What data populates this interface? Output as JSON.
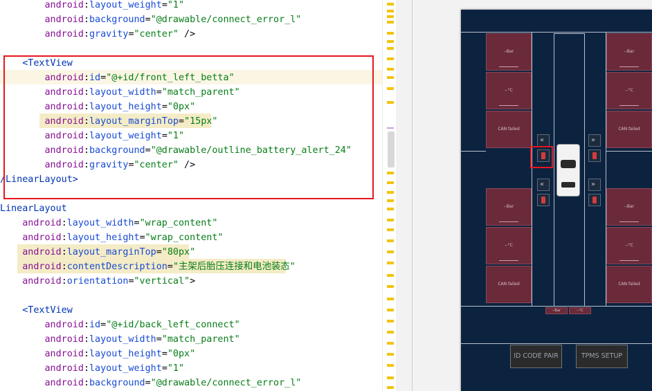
{
  "editor": {
    "lines": [
      {
        "parts": [
          {
            "c": "attr-ns",
            "t": "        android"
          },
          {
            "c": "plain",
            "t": ":"
          },
          {
            "c": "attr",
            "t": "layout_weight"
          },
          {
            "c": "plain",
            "t": "="
          },
          {
            "c": "val",
            "t": "\"1\""
          }
        ]
      },
      {
        "parts": [
          {
            "c": "attr-ns",
            "t": "        android"
          },
          {
            "c": "plain",
            "t": ":"
          },
          {
            "c": "attr",
            "t": "background"
          },
          {
            "c": "plain",
            "t": "="
          },
          {
            "c": "val",
            "t": "\"@drawable/connect_error_l\""
          }
        ]
      },
      {
        "parts": [
          {
            "c": "attr-ns",
            "t": "        android"
          },
          {
            "c": "plain",
            "t": ":"
          },
          {
            "c": "attr",
            "t": "gravity"
          },
          {
            "c": "plain",
            "t": "="
          },
          {
            "c": "val",
            "t": "\"center\""
          },
          {
            "c": "plain",
            "t": " />"
          }
        ]
      },
      {
        "parts": []
      },
      {
        "parts": [
          {
            "c": "tag",
            "t": "    <TextView"
          }
        ]
      },
      {
        "parts": [
          {
            "c": "attr-ns",
            "t": "        android"
          },
          {
            "c": "plain",
            "t": ":"
          },
          {
            "c": "attr",
            "t": "id"
          },
          {
            "c": "plain",
            "t": "="
          },
          {
            "c": "val",
            "t": "\"@+id/front_left_betta\""
          }
        ]
      },
      {
        "parts": [
          {
            "c": "attr-ns",
            "t": "        android"
          },
          {
            "c": "plain",
            "t": ":"
          },
          {
            "c": "attr",
            "t": "layout_width"
          },
          {
            "c": "plain",
            "t": "="
          },
          {
            "c": "val",
            "t": "\"match_parent\""
          }
        ]
      },
      {
        "parts": [
          {
            "c": "attr-ns",
            "t": "        android"
          },
          {
            "c": "plain",
            "t": ":"
          },
          {
            "c": "attr",
            "t": "layout_height"
          },
          {
            "c": "plain",
            "t": "="
          },
          {
            "c": "val",
            "t": "\"0px\""
          }
        ]
      },
      {
        "parts": [
          {
            "c": "attr-ns",
            "t": "        android"
          },
          {
            "c": "plain",
            "t": ":"
          },
          {
            "c": "attr",
            "t": "layout_marginTop"
          },
          {
            "c": "plain",
            "t": "="
          },
          {
            "c": "val",
            "t": "\"15px\""
          }
        ]
      },
      {
        "parts": [
          {
            "c": "attr-ns",
            "t": "        android"
          },
          {
            "c": "plain",
            "t": ":"
          },
          {
            "c": "attr",
            "t": "layout_weight"
          },
          {
            "c": "plain",
            "t": "="
          },
          {
            "c": "val",
            "t": "\"1\""
          }
        ]
      },
      {
        "parts": [
          {
            "c": "attr-ns",
            "t": "        android"
          },
          {
            "c": "plain",
            "t": ":"
          },
          {
            "c": "attr",
            "t": "background"
          },
          {
            "c": "plain",
            "t": "="
          },
          {
            "c": "val",
            "t": "\"@drawable/outline_battery_alert_24\""
          }
        ]
      },
      {
        "parts": [
          {
            "c": "attr-ns",
            "t": "        android"
          },
          {
            "c": "plain",
            "t": ":"
          },
          {
            "c": "attr",
            "t": "gravity"
          },
          {
            "c": "plain",
            "t": "="
          },
          {
            "c": "val",
            "t": "\"center\""
          },
          {
            "c": "plain",
            "t": " />"
          }
        ]
      },
      {
        "parts": [
          {
            "c": "tag",
            "t": "/LinearLayout>"
          }
        ]
      },
      {
        "parts": []
      },
      {
        "parts": [
          {
            "c": "tag",
            "t": "LinearLayout"
          }
        ]
      },
      {
        "parts": [
          {
            "c": "attr-ns",
            "t": "    android"
          },
          {
            "c": "plain",
            "t": ":"
          },
          {
            "c": "attr",
            "t": "layout_width"
          },
          {
            "c": "plain",
            "t": "="
          },
          {
            "c": "val",
            "t": "\"wrap_content\""
          }
        ]
      },
      {
        "parts": [
          {
            "c": "attr-ns",
            "t": "    android"
          },
          {
            "c": "plain",
            "t": ":"
          },
          {
            "c": "attr",
            "t": "layout_height"
          },
          {
            "c": "plain",
            "t": "="
          },
          {
            "c": "val",
            "t": "\"wrap_content\""
          }
        ]
      },
      {
        "parts": [
          {
            "c": "attr-ns",
            "t": "    android"
          },
          {
            "c": "plain",
            "t": ":"
          },
          {
            "c": "attr",
            "t": "layout_marginTop"
          },
          {
            "c": "plain",
            "t": "="
          },
          {
            "c": "val",
            "t": "\"80px\""
          }
        ]
      },
      {
        "parts": [
          {
            "c": "attr-ns",
            "t": "    android"
          },
          {
            "c": "plain",
            "t": ":"
          },
          {
            "c": "attr",
            "t": "contentDescription"
          },
          {
            "c": "plain",
            "t": "="
          },
          {
            "c": "val",
            "t": "\"主架后胎压连接和电池装态\""
          }
        ]
      },
      {
        "parts": [
          {
            "c": "attr-ns",
            "t": "    android"
          },
          {
            "c": "plain",
            "t": ":"
          },
          {
            "c": "attr",
            "t": "orientation"
          },
          {
            "c": "plain",
            "t": "="
          },
          {
            "c": "val",
            "t": "\"vertical\""
          },
          {
            "c": "plain",
            "t": ">"
          }
        ]
      },
      {
        "parts": []
      },
      {
        "parts": [
          {
            "c": "tag",
            "t": "    <TextView"
          }
        ]
      },
      {
        "parts": [
          {
            "c": "attr-ns",
            "t": "        android"
          },
          {
            "c": "plain",
            "t": ":"
          },
          {
            "c": "attr",
            "t": "id"
          },
          {
            "c": "plain",
            "t": "="
          },
          {
            "c": "val",
            "t": "\"@+id/back_left_connect\""
          }
        ]
      },
      {
        "parts": [
          {
            "c": "attr-ns",
            "t": "        android"
          },
          {
            "c": "plain",
            "t": ":"
          },
          {
            "c": "attr",
            "t": "layout_width"
          },
          {
            "c": "plain",
            "t": "="
          },
          {
            "c": "val",
            "t": "\"match_parent\""
          }
        ]
      },
      {
        "parts": [
          {
            "c": "attr-ns",
            "t": "        android"
          },
          {
            "c": "plain",
            "t": ":"
          },
          {
            "c": "attr",
            "t": "layout_height"
          },
          {
            "c": "plain",
            "t": "="
          },
          {
            "c": "val",
            "t": "\"0px\""
          }
        ]
      },
      {
        "parts": [
          {
            "c": "attr-ns",
            "t": "        android"
          },
          {
            "c": "plain",
            "t": ":"
          },
          {
            "c": "attr",
            "t": "layout_weight"
          },
          {
            "c": "plain",
            "t": "="
          },
          {
            "c": "val",
            "t": "\"1\""
          }
        ]
      },
      {
        "parts": [
          {
            "c": "attr-ns",
            "t": "        android"
          },
          {
            "c": "plain",
            "t": ":"
          },
          {
            "c": "attr",
            "t": "background"
          },
          {
            "c": "plain",
            "t": "="
          },
          {
            "c": "val",
            "t": "\"@drawable/connect_error_l\""
          }
        ]
      }
    ]
  },
  "preview": {
    "tiles_left": [
      "--Bar",
      "--°C",
      "CAN failed",
      "--Bar",
      "--°C",
      "CAN failed"
    ],
    "tiles_right": [
      "--Bar",
      "--°C",
      "CAN failed",
      "--Bar",
      "--°C",
      "CAN failed"
    ],
    "chips": [
      "--Bar",
      "--°C"
    ],
    "buttons": {
      "id_code_pair": "ID CODE PAIR",
      "tpms_setup": "TPMS SETUP"
    }
  },
  "colors": {
    "highlight_box": "#e5161d",
    "device_bg": "#0c2340",
    "tile_bg": "#6b2a3a"
  }
}
